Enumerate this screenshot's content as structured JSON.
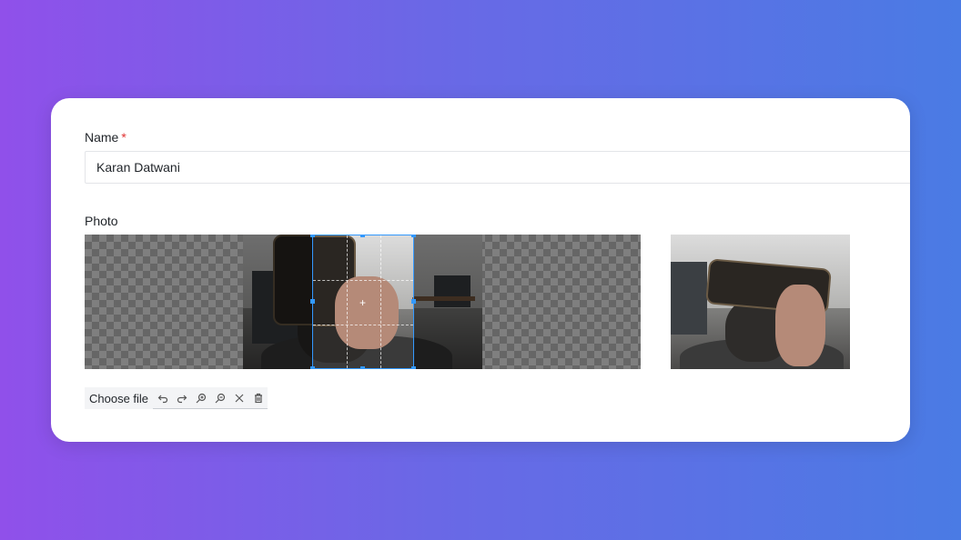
{
  "form": {
    "name_label": "Name",
    "required_mark": "*",
    "name_value": "Karan Datwani",
    "photo_label": "Photo"
  },
  "toolbar": {
    "choose_file_label": "Choose file",
    "buttons": [
      "undo-icon",
      "redo-icon",
      "zoom-in-icon",
      "zoom-out-icon",
      "close-icon",
      "trash-icon"
    ]
  },
  "colors": {
    "accent": "#3399ff",
    "required": "#e03131",
    "gradient_start": "#9050ea",
    "gradient_end": "#4a7be4"
  }
}
